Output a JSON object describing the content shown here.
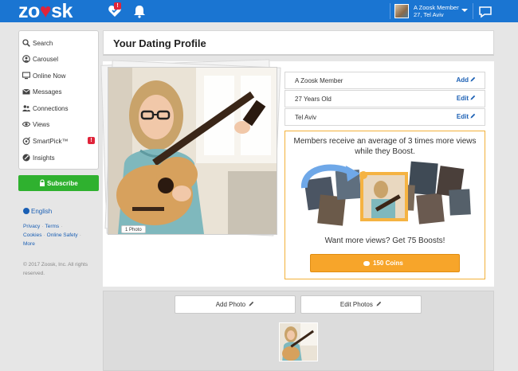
{
  "header": {
    "logo_text": "zoosk",
    "notification_badge": "!",
    "user_name": "A Zoosk Member",
    "user_age_location": "27, Tel Aviv",
    "icons": [
      "heart-check-icon",
      "bell-icon",
      "caret-down-icon",
      "chat-bubble-icon"
    ]
  },
  "sidebar": {
    "items": [
      {
        "label": "Search",
        "icon": "search-icon"
      },
      {
        "label": "Carousel",
        "icon": "carousel-icon"
      },
      {
        "label": "Online Now",
        "icon": "monitor-icon"
      },
      {
        "label": "Messages",
        "icon": "envelope-icon"
      },
      {
        "label": "Connections",
        "icon": "people-icon"
      },
      {
        "label": "Views",
        "icon": "eye-icon"
      },
      {
        "label": "SmartPick™",
        "icon": "smartpick-icon",
        "badge": "!"
      },
      {
        "label": "Insights",
        "icon": "insights-icon"
      }
    ],
    "subscribe_label": "Subscribe"
  },
  "footer": {
    "language": "English",
    "links": [
      "Privacy",
      "Terms",
      "Cookies",
      "Online Safety",
      "More"
    ],
    "copyright": "© 2017 Zoosk, Inc. All rights reserved."
  },
  "profile": {
    "page_title": "Your Dating Profile",
    "photo_count": "1 Photo",
    "fields": [
      {
        "value": "A Zoosk Member",
        "action": "Add"
      },
      {
        "value": "27 Years Old",
        "action": "Edit"
      },
      {
        "value": "Tel Aviv",
        "action": "Edit"
      }
    ]
  },
  "boost": {
    "headline": "Members receive an average of 3 times more views while they Boost.",
    "subline": "Want more views? Get 75 Boosts!",
    "button_label": "150 Coins"
  },
  "photos_panel": {
    "add_label": "Add Photo",
    "edit_label": "Edit Photos"
  },
  "colors": {
    "brand_blue": "#1a75d2",
    "alert_red": "#e0243a",
    "subscribe_green": "#2fb12f",
    "boost_orange": "#f7a52a",
    "link_blue": "#1a5fb4"
  }
}
